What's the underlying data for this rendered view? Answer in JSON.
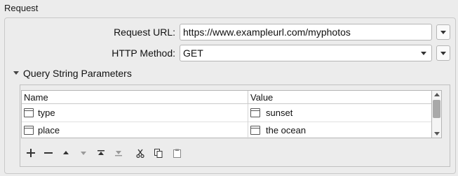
{
  "section": {
    "title": "Request"
  },
  "form": {
    "url_label": "Request URL:",
    "url_value": "https://www.exampleurl.com/myphotos",
    "method_label": "HTTP Method:",
    "method_value": "GET"
  },
  "query_params": {
    "title": "Query String Parameters",
    "columns": [
      "Name",
      "Value"
    ],
    "rows": [
      {
        "name": "type",
        "value": "sunset"
      },
      {
        "name": "place",
        "value": "the ocean"
      }
    ]
  },
  "toolbar": {
    "icons": [
      "add-icon",
      "remove-icon",
      "move-up-icon",
      "move-down-icon",
      "move-top-icon",
      "move-bottom-icon",
      "cut-icon",
      "copy-icon",
      "paste-icon"
    ]
  },
  "colors": {
    "background": "#ececec",
    "border": "#b5b5b5",
    "disabled_icon": "#9a9a9a",
    "icon": "#333333"
  }
}
